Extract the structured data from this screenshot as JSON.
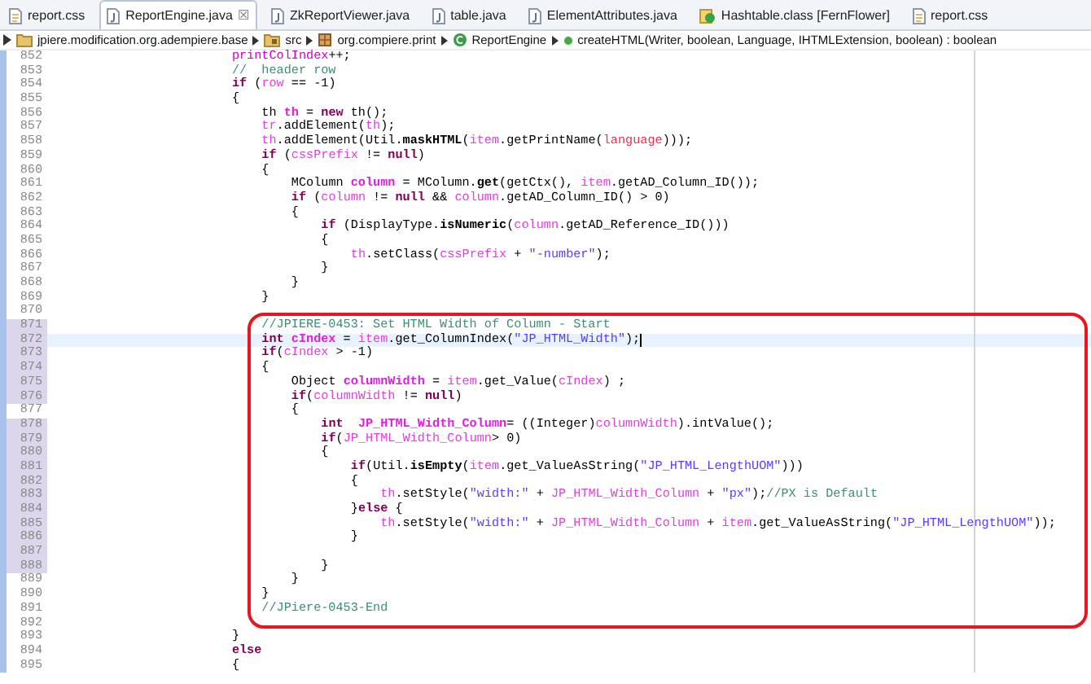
{
  "tabs": [
    {
      "label": "report.css",
      "kind": "css",
      "selected": false
    },
    {
      "label": "ReportEngine.java",
      "kind": "java",
      "selected": true,
      "close": "☒"
    },
    {
      "label": "ZkReportViewer.java",
      "kind": "java",
      "selected": false
    },
    {
      "label": "table.java",
      "kind": "java",
      "selected": false
    },
    {
      "label": "ElementAttributes.java",
      "kind": "java",
      "selected": false
    },
    {
      "label": "Hashtable.class [FernFlower]",
      "kind": "class",
      "selected": false
    },
    {
      "label": "report.css",
      "kind": "css",
      "selected": false
    }
  ],
  "breadcrumb": [
    {
      "label": "jpiere.modification.org.adempiere.base",
      "kind": "project"
    },
    {
      "label": "src",
      "kind": "source"
    },
    {
      "label": "org.compiere.print",
      "kind": "package"
    },
    {
      "label": "ReportEngine",
      "kind": "class"
    },
    {
      "label": "createHTML(Writer, boolean, Language, IHTMLExtension, boolean) : boolean",
      "kind": "method"
    }
  ],
  "editor": {
    "lines": [
      {
        "number": "852",
        "changed": false,
        "current": false,
        "segments": [
          {
            "kind": "field",
            "text": "                        printColIndex"
          },
          {
            "kind": "plain",
            "text": "++;"
          }
        ]
      },
      {
        "number": "853",
        "changed": false,
        "current": false,
        "segments": [
          {
            "kind": "comment",
            "text": "                        //  header row"
          }
        ]
      },
      {
        "number": "854",
        "changed": false,
        "current": false,
        "segments": [
          {
            "kind": "keyword",
            "text": "                        if"
          },
          {
            "kind": "plain",
            "text": " ("
          },
          {
            "kind": "local",
            "text": "row"
          },
          {
            "kind": "plain",
            "text": " == -1)"
          }
        ]
      },
      {
        "number": "855",
        "changed": false,
        "current": false,
        "segments": [
          {
            "kind": "plain",
            "text": "                        {"
          }
        ]
      },
      {
        "number": "856",
        "changed": false,
        "current": false,
        "segments": [
          {
            "kind": "plain",
            "text": "                            th "
          },
          {
            "kind": "decl",
            "text": "th"
          },
          {
            "kind": "plain",
            "text": " = "
          },
          {
            "kind": "keyword",
            "text": "new"
          },
          {
            "kind": "plain",
            "text": " th();"
          }
        ]
      },
      {
        "number": "857",
        "changed": false,
        "current": false,
        "segments": [
          {
            "kind": "local",
            "text": "                            tr"
          },
          {
            "kind": "plain",
            "text": ".addElement("
          },
          {
            "kind": "local",
            "text": "th"
          },
          {
            "kind": "plain",
            "text": ");"
          }
        ]
      },
      {
        "number": "858",
        "changed": false,
        "current": false,
        "segments": [
          {
            "kind": "local",
            "text": "                            th"
          },
          {
            "kind": "plain",
            "text": ".addElement(Util."
          },
          {
            "kind": "static",
            "text": "maskHTML"
          },
          {
            "kind": "plain",
            "text": "("
          },
          {
            "kind": "local",
            "text": "item"
          },
          {
            "kind": "plain",
            "text": ".getPrintName("
          },
          {
            "kind": "param",
            "text": "language"
          },
          {
            "kind": "plain",
            "text": ")));"
          }
        ]
      },
      {
        "number": "859",
        "changed": false,
        "current": false,
        "segments": [
          {
            "kind": "keyword",
            "text": "                            if"
          },
          {
            "kind": "plain",
            "text": " ("
          },
          {
            "kind": "local",
            "text": "cssPrefix"
          },
          {
            "kind": "plain",
            "text": " != "
          },
          {
            "kind": "keyword",
            "text": "null"
          },
          {
            "kind": "plain",
            "text": ")"
          }
        ]
      },
      {
        "number": "860",
        "changed": false,
        "current": false,
        "segments": [
          {
            "kind": "plain",
            "text": "                            {"
          }
        ]
      },
      {
        "number": "861",
        "changed": false,
        "current": false,
        "segments": [
          {
            "kind": "plain",
            "text": "                                MColumn "
          },
          {
            "kind": "decl",
            "text": "column"
          },
          {
            "kind": "plain",
            "text": " = MColumn."
          },
          {
            "kind": "static",
            "text": "get"
          },
          {
            "kind": "plain",
            "text": "(getCtx(), "
          },
          {
            "kind": "local",
            "text": "item"
          },
          {
            "kind": "plain",
            "text": ".getAD_Column_ID());"
          }
        ]
      },
      {
        "number": "862",
        "changed": false,
        "current": false,
        "segments": [
          {
            "kind": "keyword",
            "text": "                                if"
          },
          {
            "kind": "plain",
            "text": " ("
          },
          {
            "kind": "local",
            "text": "column"
          },
          {
            "kind": "plain",
            "text": " != "
          },
          {
            "kind": "keyword",
            "text": "null"
          },
          {
            "kind": "plain",
            "text": " && "
          },
          {
            "kind": "local",
            "text": "column"
          },
          {
            "kind": "plain",
            "text": ".getAD_Column_ID() > 0)"
          }
        ]
      },
      {
        "number": "863",
        "changed": false,
        "current": false,
        "segments": [
          {
            "kind": "plain",
            "text": "                                {"
          }
        ]
      },
      {
        "number": "864",
        "changed": false,
        "current": false,
        "segments": [
          {
            "kind": "keyword",
            "text": "                                    if"
          },
          {
            "kind": "plain",
            "text": " (DisplayType."
          },
          {
            "kind": "static",
            "text": "isNumeric"
          },
          {
            "kind": "plain",
            "text": "("
          },
          {
            "kind": "local",
            "text": "column"
          },
          {
            "kind": "plain",
            "text": ".getAD_Reference_ID()))"
          }
        ]
      },
      {
        "number": "865",
        "changed": false,
        "current": false,
        "segments": [
          {
            "kind": "plain",
            "text": "                                    {"
          }
        ]
      },
      {
        "number": "866",
        "changed": false,
        "current": false,
        "segments": [
          {
            "kind": "local",
            "text": "                                        th"
          },
          {
            "kind": "plain",
            "text": ".setClass("
          },
          {
            "kind": "local",
            "text": "cssPrefix"
          },
          {
            "kind": "plain",
            "text": " + "
          },
          {
            "kind": "string",
            "text": "\"-number\""
          },
          {
            "kind": "plain",
            "text": ");"
          }
        ]
      },
      {
        "number": "867",
        "changed": false,
        "current": false,
        "segments": [
          {
            "kind": "plain",
            "text": "                                    }"
          }
        ]
      },
      {
        "number": "868",
        "changed": false,
        "current": false,
        "segments": [
          {
            "kind": "plain",
            "text": "                                }"
          }
        ]
      },
      {
        "number": "869",
        "changed": false,
        "current": false,
        "segments": [
          {
            "kind": "plain",
            "text": "                            }"
          }
        ]
      },
      {
        "number": "870",
        "changed": false,
        "current": false
      },
      {
        "number": "871",
        "changed": true,
        "current": false,
        "segments": [
          {
            "kind": "comment",
            "text": "                            //JPIERE-0453: Set HTML Width of Column - Start"
          }
        ]
      },
      {
        "number": "872",
        "changed": true,
        "current": true,
        "segments": [
          {
            "kind": "keyword",
            "text": "                            int"
          },
          {
            "kind": "decl",
            "text": " cIndex"
          },
          {
            "kind": "plain",
            "text": " = "
          },
          {
            "kind": "local",
            "text": "item"
          },
          {
            "kind": "plain",
            "text": ".get_ColumnIndex("
          },
          {
            "kind": "string",
            "text": "\"JP_HTML_Width\""
          },
          {
            "kind": "plain",
            "text": ");"
          }
        ]
      },
      {
        "number": "873",
        "changed": true,
        "current": false,
        "segments": [
          {
            "kind": "keyword",
            "text": "                            if"
          },
          {
            "kind": "plain",
            "text": "("
          },
          {
            "kind": "local",
            "text": "cIndex"
          },
          {
            "kind": "plain",
            "text": " > -1)"
          }
        ]
      },
      {
        "number": "874",
        "changed": true,
        "current": false,
        "segments": [
          {
            "kind": "plain",
            "text": "                            {"
          }
        ]
      },
      {
        "number": "875",
        "changed": true,
        "current": false,
        "segments": [
          {
            "kind": "plain",
            "text": "                                Object "
          },
          {
            "kind": "decl",
            "text": "columnWidth"
          },
          {
            "kind": "plain",
            "text": " = "
          },
          {
            "kind": "local",
            "text": "item"
          },
          {
            "kind": "plain",
            "text": ".get_Value("
          },
          {
            "kind": "local",
            "text": "cIndex"
          },
          {
            "kind": "plain",
            "text": ") ;"
          }
        ]
      },
      {
        "number": "876",
        "changed": true,
        "current": false,
        "segments": [
          {
            "kind": "keyword",
            "text": "                                if"
          },
          {
            "kind": "plain",
            "text": "("
          },
          {
            "kind": "local",
            "text": "columnWidth"
          },
          {
            "kind": "plain",
            "text": " != "
          },
          {
            "kind": "keyword",
            "text": "null"
          },
          {
            "kind": "plain",
            "text": ")"
          }
        ]
      },
      {
        "number": "877",
        "changed": false,
        "current": false,
        "segments": [
          {
            "kind": "plain",
            "text": "                                {"
          }
        ]
      },
      {
        "number": "878",
        "changed": true,
        "current": false,
        "segments": [
          {
            "kind": "keyword",
            "text": "                                    int"
          },
          {
            "kind": "decl",
            "text": "  JP_HTML_Width_Column"
          },
          {
            "kind": "plain",
            "text": "= ((Integer)"
          },
          {
            "kind": "local",
            "text": "columnWidth"
          },
          {
            "kind": "plain",
            "text": ").intValue();"
          }
        ]
      },
      {
        "number": "879",
        "changed": true,
        "current": false,
        "segments": [
          {
            "kind": "keyword",
            "text": "                                    if"
          },
          {
            "kind": "plain",
            "text": "("
          },
          {
            "kind": "local",
            "text": "JP_HTML_Width_Column"
          },
          {
            "kind": "plain",
            "text": "> 0)"
          }
        ]
      },
      {
        "number": "880",
        "changed": true,
        "current": false,
        "segments": [
          {
            "kind": "plain",
            "text": "                                    {"
          }
        ]
      },
      {
        "number": "881",
        "changed": true,
        "current": false,
        "segments": [
          {
            "kind": "keyword",
            "text": "                                        if"
          },
          {
            "kind": "plain",
            "text": "(Util."
          },
          {
            "kind": "static",
            "text": "isEmpty"
          },
          {
            "kind": "plain",
            "text": "("
          },
          {
            "kind": "local",
            "text": "item"
          },
          {
            "kind": "plain",
            "text": ".get_ValueAsString("
          },
          {
            "kind": "string",
            "text": "\"JP_HTML_LengthUOM\""
          },
          {
            "kind": "plain",
            "text": ")))"
          }
        ]
      },
      {
        "number": "882",
        "changed": true,
        "current": false,
        "segments": [
          {
            "kind": "plain",
            "text": "                                        {"
          }
        ]
      },
      {
        "number": "883",
        "changed": true,
        "current": false,
        "segments": [
          {
            "kind": "local",
            "text": "                                            th"
          },
          {
            "kind": "plain",
            "text": ".setStyle("
          },
          {
            "kind": "string",
            "text": "\"width:\""
          },
          {
            "kind": "plain",
            "text": " + "
          },
          {
            "kind": "local",
            "text": "JP_HTML_Width_Column"
          },
          {
            "kind": "plain",
            "text": " + "
          },
          {
            "kind": "string",
            "text": "\"px\""
          },
          {
            "kind": "plain",
            "text": ");"
          },
          {
            "kind": "comment",
            "text": "//PX is Default"
          }
        ]
      },
      {
        "number": "884",
        "changed": true,
        "current": false,
        "segments": [
          {
            "kind": "plain",
            "text": "                                        }"
          },
          {
            "kind": "keyword",
            "text": "else"
          },
          {
            "kind": "plain",
            "text": " {"
          }
        ]
      },
      {
        "number": "885",
        "changed": true,
        "current": false,
        "segments": [
          {
            "kind": "local",
            "text": "                                            th"
          },
          {
            "kind": "plain",
            "text": ".setStyle("
          },
          {
            "kind": "string",
            "text": "\"width:\""
          },
          {
            "kind": "plain",
            "text": " + "
          },
          {
            "kind": "local",
            "text": "JP_HTML_Width_Column"
          },
          {
            "kind": "plain",
            "text": " + "
          },
          {
            "kind": "local",
            "text": "item"
          },
          {
            "kind": "plain",
            "text": ".get_ValueAsString("
          },
          {
            "kind": "string",
            "text": "\"JP_HTML_LengthUOM\""
          },
          {
            "kind": "plain",
            "text": "));"
          }
        ]
      },
      {
        "number": "886",
        "changed": true,
        "current": false,
        "segments": [
          {
            "kind": "plain",
            "text": "                                        }"
          }
        ]
      },
      {
        "number": "887",
        "changed": true,
        "current": false
      },
      {
        "number": "888",
        "changed": true,
        "current": false,
        "segments": [
          {
            "kind": "plain",
            "text": "                                    }"
          }
        ]
      },
      {
        "number": "889",
        "changed": false,
        "current": false,
        "segments": [
          {
            "kind": "plain",
            "text": "                                }"
          }
        ]
      },
      {
        "number": "890",
        "changed": false,
        "current": false,
        "segments": [
          {
            "kind": "plain",
            "text": "                            }"
          }
        ]
      },
      {
        "number": "891",
        "changed": false,
        "current": false,
        "segments": [
          {
            "kind": "comment",
            "text": "                            //JPiere-0453-End"
          }
        ]
      },
      {
        "number": "892",
        "changed": false,
        "current": false
      },
      {
        "number": "893",
        "changed": false,
        "current": false,
        "segments": [
          {
            "kind": "plain",
            "text": "                        }"
          }
        ]
      },
      {
        "number": "894",
        "changed": false,
        "current": false,
        "segments": [
          {
            "kind": "keyword",
            "text": "                        else"
          }
        ]
      },
      {
        "number": "895",
        "changed": false,
        "current": false,
        "segments": [
          {
            "kind": "plain",
            "text": "                        {"
          }
        ]
      }
    ]
  }
}
